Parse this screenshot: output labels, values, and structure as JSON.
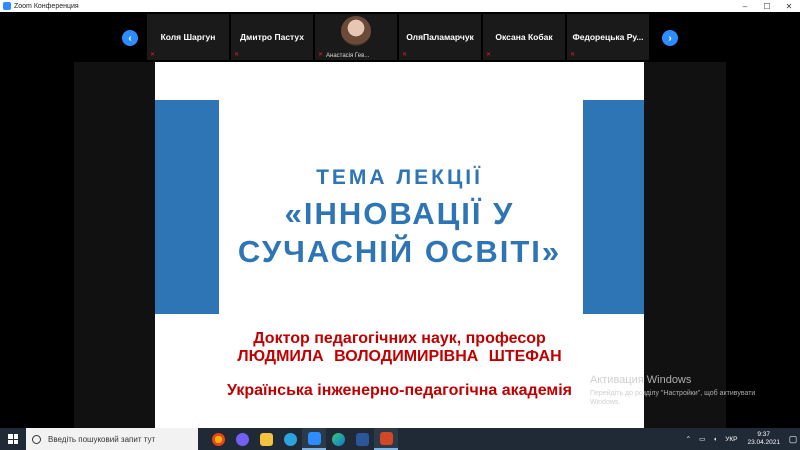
{
  "window": {
    "title": "Zoom Конференция"
  },
  "participants": [
    {
      "name": "Коля Шаргун"
    },
    {
      "name": "Дмитро Пастух"
    },
    {
      "name": "",
      "label": "Анастасія Гев..."
    },
    {
      "name": "ОляПаламарчук"
    },
    {
      "name": "Оксана Кобак"
    },
    {
      "name": "Федорецька Ру..."
    }
  ],
  "slide": {
    "heading_line1": "ТЕМА ЛЕКЦІЇ",
    "heading_line2": "«ІННОВАЦІЇ У",
    "heading_line3": "СУЧАСНІЙ ОСВІТІ»",
    "author_line1": "Доктор педагогічних наук, професор",
    "author_line2": "ЛЮДМИЛА ВОЛОДИМИРІВНА ШТЕФАН",
    "organization": "Українська інженерно-педагогічна академія",
    "accent_color": "#2E75B6",
    "text_color": "#C00000"
  },
  "watermark": {
    "title": "Активация Windows",
    "subtitle": "Перейдіть до розділу \"Настройки\", щоб активувати Windows."
  },
  "taskbar": {
    "search_placeholder": "Введіть пошуковий запит тут",
    "language": "УКР",
    "time": "9:37",
    "date": "23.04.2021"
  }
}
